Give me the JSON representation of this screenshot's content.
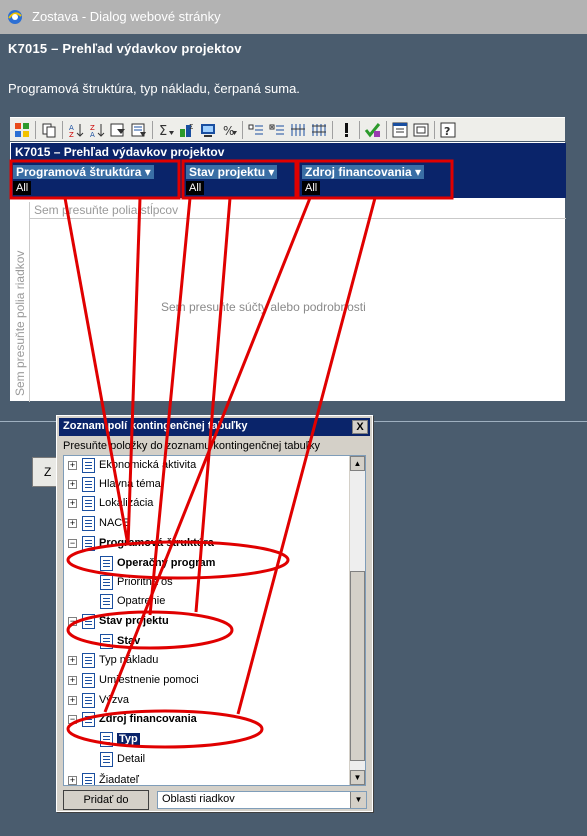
{
  "window": {
    "title": "Zostava - Dialog webové stránky"
  },
  "report": {
    "title": "K7015 – Prehľad výdavkov projektov",
    "subtitle": "Programová štruktúra, typ nákladu, čerpaná suma."
  },
  "toolbar": {
    "buttons": [
      "office-logo-icon",
      "copy-icon",
      "sort-ascending-icon",
      "sort-descending-icon",
      "autofilter-icon",
      "show-top-icon",
      "autocalc-icon",
      "subtotal-icon",
      "calculated-totals-icon",
      "show-as-icon",
      "collapse-icon",
      "expand-icon",
      "hide-details-icon",
      "show-details-icon",
      "refresh-icon",
      "export-excel-icon",
      "field-list-icon",
      "properties-icon",
      "help-icon"
    ]
  },
  "pivot": {
    "title": "K7015 – Prehľad výdavkov projektov",
    "filters": [
      {
        "name": "Programová štruktúra",
        "value": "All"
      },
      {
        "name": "Stav projektu",
        "value": "All"
      },
      {
        "name": "Zdroj financovania",
        "value": "All"
      }
    ],
    "column_drop": "Sem presuňte polia stĺpcov",
    "row_drop": "Sem presuňte polia riadkov",
    "data_drop": "Sem presuňte súčty alebo podrobnosti"
  },
  "back_button_label": "Z",
  "field_list": {
    "title": "Zoznam polí kontingenčnej tabuľky",
    "close_label": "X",
    "hint": "Presuňte položky do zoznamu kontingenčnej tabuľky",
    "items": [
      {
        "label": "Ekonomická aktivita",
        "expander": "+"
      },
      {
        "label": "Hlavná téma",
        "expander": "+"
      },
      {
        "label": "Lokalizácia",
        "expander": "+"
      },
      {
        "label": "NACE",
        "expander": "+"
      },
      {
        "label": "Programová štruktúra",
        "expander": "−"
      },
      {
        "label": "Operačný program"
      },
      {
        "label": "Prioritná os"
      },
      {
        "label": "Opatrenie"
      },
      {
        "label": "Stav projektu",
        "expander": "−"
      },
      {
        "label": "Stav"
      },
      {
        "label": "Typ nákladu",
        "expander": "+"
      },
      {
        "label": "Umiestnenie pomoci",
        "expander": "+"
      },
      {
        "label": "Výzva",
        "expander": "+"
      },
      {
        "label": "Zdroj financovania",
        "expander": "−"
      },
      {
        "label": "Typ"
      },
      {
        "label": "Detail"
      },
      {
        "label": "Žiadateľ",
        "expander": "+"
      }
    ],
    "add_button": "Pridať do",
    "area_select": "Oblasti riadkov"
  },
  "colors": {
    "window_bg": "#4a5c6e",
    "header_blue": "#0a246a",
    "annotation_red": "#e00000"
  }
}
